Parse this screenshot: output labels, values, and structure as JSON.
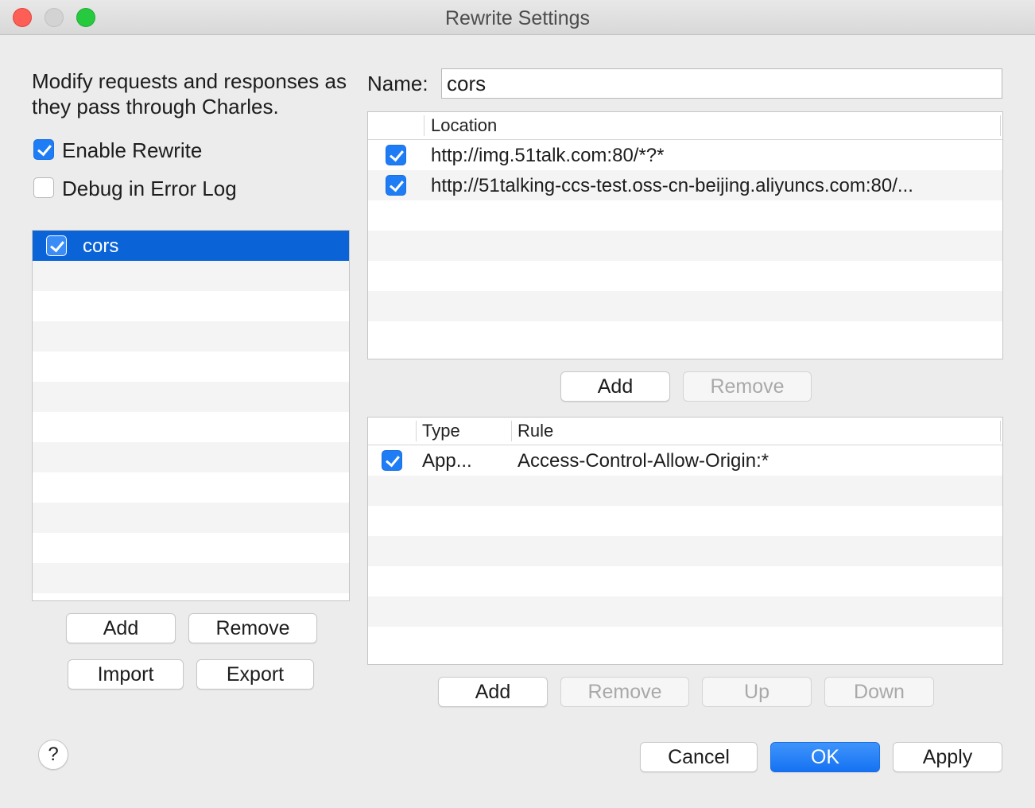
{
  "window": {
    "title": "Rewrite Settings"
  },
  "description": "Modify requests and responses as they pass through Charles.",
  "options": {
    "enable_rewrite": {
      "label": "Enable Rewrite",
      "checked": true
    },
    "debug_error_log": {
      "label": "Debug in Error Log",
      "checked": false
    }
  },
  "sets": {
    "items": [
      {
        "label": "cors",
        "checked": true,
        "selected": true
      }
    ],
    "buttons": {
      "add": "Add",
      "remove": "Remove",
      "import": "Import",
      "export": "Export"
    }
  },
  "detail": {
    "name_label": "Name:",
    "name_value": "cors",
    "locations": {
      "header": "Location",
      "rows": [
        {
          "checked": true,
          "location": "http://img.51talk.com:80/*?*"
        },
        {
          "checked": true,
          "location": "http://51talking-ccs-test.oss-cn-beijing.aliyuncs.com:80/..."
        }
      ],
      "buttons": {
        "add": "Add",
        "remove": "Remove"
      }
    },
    "rules": {
      "headers": {
        "type": "Type",
        "rule": "Rule"
      },
      "rows": [
        {
          "checked": true,
          "type": "App...",
          "rule": "Access-Control-Allow-Origin:*"
        }
      ],
      "buttons": {
        "add": "Add",
        "remove": "Remove",
        "up": "Up",
        "down": "Down"
      }
    }
  },
  "footer": {
    "help": "?",
    "cancel": "Cancel",
    "ok": "OK",
    "apply": "Apply"
  },
  "colors": {
    "accent": "#1e7cf5",
    "selection": "#0a64d8"
  }
}
